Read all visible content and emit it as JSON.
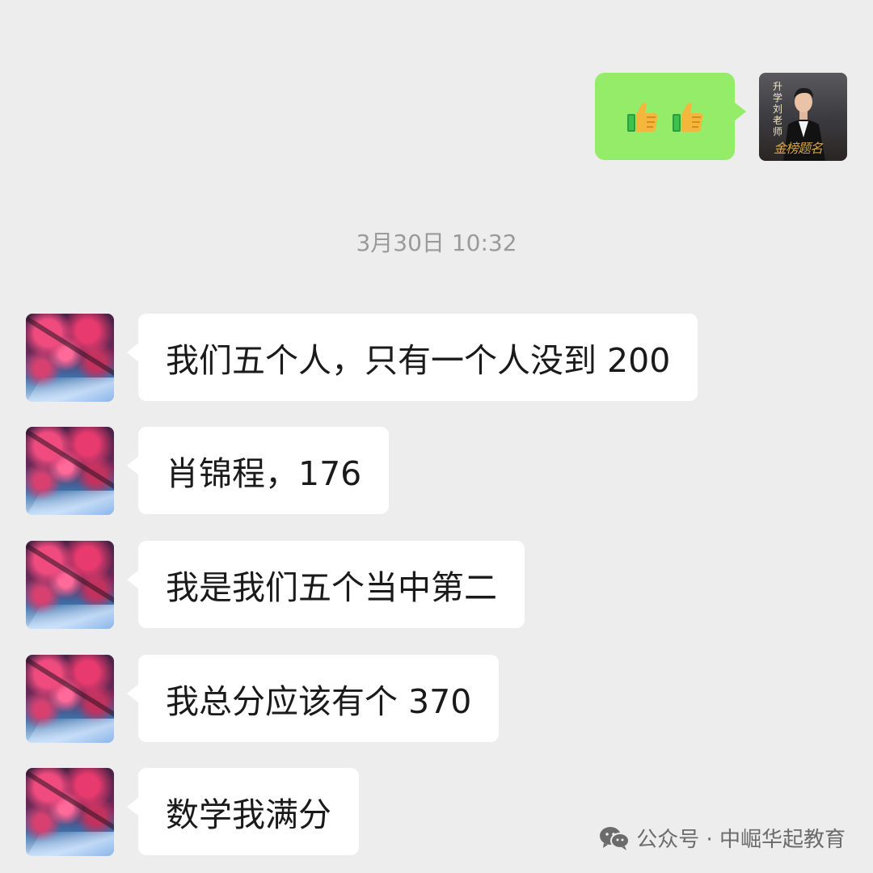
{
  "messages_out": [
    {
      "content": "👍👍",
      "icon_names": [
        "thumbs-up-icon",
        "thumbs-up-icon"
      ]
    }
  ],
  "teacher_avatar": {
    "tag_text": "升学刘老师",
    "script_text": "金榜题名"
  },
  "timestamp": "3月30日 10:32",
  "messages_in": [
    {
      "text": "我们五个人，只有一个人没到 200"
    },
    {
      "text": "肖锦程，176"
    },
    {
      "text": "我是我们五个当中第二"
    },
    {
      "text": "我总分应该有个 370"
    },
    {
      "text": "数学我满分"
    }
  ],
  "watermark": {
    "label": "公众号 · 中崛华起教育",
    "icon": "wechat-icon"
  },
  "colors": {
    "background": "#ededed",
    "outgoing_bubble": "#95ec69",
    "incoming_bubble": "#ffffff",
    "timestamp_text": "#9a9a9a"
  }
}
